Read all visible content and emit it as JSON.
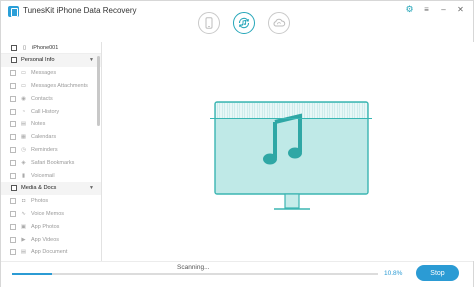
{
  "app": {
    "title": "TunesKit iPhone Data Recovery",
    "accent": "#2b9bd4",
    "teal": "#25a6b9"
  },
  "modes": [
    {
      "icon": "iphone-icon"
    },
    {
      "icon": "itunes-sync-icon"
    },
    {
      "icon": "icloud-icon"
    }
  ],
  "window_controls": {
    "settings_icon": "gear-icon",
    "menu_icon": "menu-icon",
    "minimize": "–",
    "close": "✕"
  },
  "sidebar": {
    "device": {
      "label": "iPhone001"
    },
    "sections": [
      {
        "label": "Personal Info",
        "items": [
          {
            "label": "Messages",
            "icon": "message-icon"
          },
          {
            "label": "Messages Attachments",
            "icon": "attachment-icon"
          },
          {
            "label": "Contacts",
            "icon": "contacts-icon"
          },
          {
            "label": "Call History",
            "icon": "phone-icon"
          },
          {
            "label": "Notes",
            "icon": "notes-icon"
          },
          {
            "label": "Calendars",
            "icon": "calendar-icon"
          },
          {
            "label": "Reminders",
            "icon": "reminder-icon"
          },
          {
            "label": "Safari Bookmarks",
            "icon": "safari-icon"
          },
          {
            "label": "Voicemail",
            "icon": "voicemail-icon"
          }
        ]
      },
      {
        "label": "Media & Docs",
        "items": [
          {
            "label": "Photos",
            "icon": "camera-icon"
          },
          {
            "label": "Voice Memos",
            "icon": "voice-memo-icon"
          },
          {
            "label": "App Photos",
            "icon": "app-photo-icon"
          },
          {
            "label": "App Videos",
            "icon": "app-video-icon"
          },
          {
            "label": "App Document",
            "icon": "app-document-icon"
          }
        ]
      }
    ]
  },
  "main": {
    "illustration": "monitor-music-note-icon",
    "scan_progress": 0.108
  },
  "footer": {
    "status": "Scanning...",
    "percent": "10.8%",
    "progress": 0.108,
    "stop_label": "Stop"
  }
}
